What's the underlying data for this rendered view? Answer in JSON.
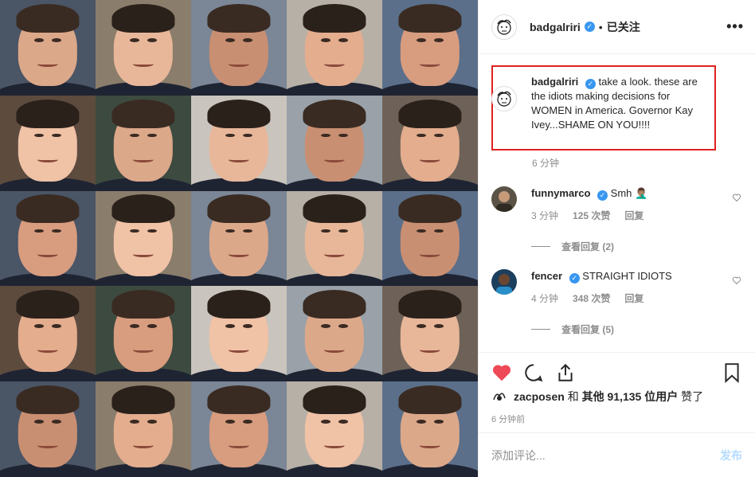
{
  "header": {
    "username": "badgalriri",
    "separator": "•",
    "follow_label": "已关注",
    "more_label": "•••"
  },
  "caption": {
    "username": "badgalriri",
    "text": "take a look. these are the idiots making decisions for WOMEN in America. Governor Kay Ivey...SHAME ON YOU!!!!",
    "time": "6 分钟"
  },
  "comments": [
    {
      "username": "funnymarco",
      "text": "Smh 🤦🏽‍♂️",
      "time": "3 分钟",
      "likes": "125 次赞",
      "reply_label": "回复",
      "view_replies": "查看回复 (2)"
    },
    {
      "username": "fencer",
      "text": "STRAIGHT IDIOTS",
      "time": "4 分钟",
      "likes": "348 次赞",
      "reply_label": "回复",
      "view_replies": "查看回复 (5)"
    }
  ],
  "likes": {
    "user": "zacposen",
    "and_label": "和",
    "others_label": "其他",
    "count": "91,135",
    "suffix_users": "位用户",
    "suffix_liked": "赞了"
  },
  "posted": "6 分钟前",
  "add_comment": {
    "placeholder": "添加评论...",
    "post_label": "发布"
  },
  "colors": {
    "like_red": "#ed4956",
    "verified_blue": "#3897f0",
    "highlight_box": "#e02020"
  }
}
